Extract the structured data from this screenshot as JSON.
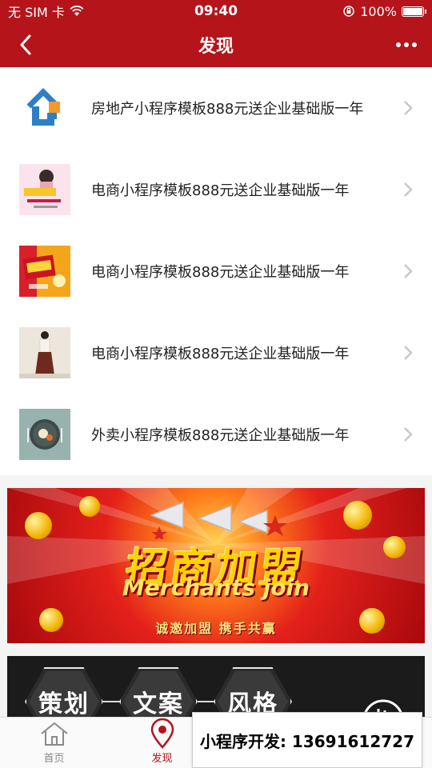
{
  "statusbar": {
    "carrier": "无 SIM 卡",
    "time": "09:40",
    "battery": "100%"
  },
  "navbar": {
    "title": "发现",
    "back_icon": "chevron-left-icon",
    "more_icon": "more-dots-icon"
  },
  "items": [
    {
      "title": "房地产小程序模板888元送企业基础版一年",
      "thumb": "real-estate-logo"
    },
    {
      "title": "电商小程序模板888元送企业基础版一年",
      "thumb": "ecommerce-promo-1"
    },
    {
      "title": "电商小程序模板888元送企业基础版一年",
      "thumb": "ecommerce-promo-2"
    },
    {
      "title": "电商小程序模板888元送企业基础版一年",
      "thumb": "fashion-model"
    },
    {
      "title": "外卖小程序模板888元送企业基础版一年",
      "thumb": "food-plate"
    }
  ],
  "banner": {
    "main": "招商加盟",
    "english": "Merchants join",
    "slogan": "诚邀加盟   携手共赢"
  },
  "banner2": {
    "labels": [
      "策划",
      "文案",
      "风格"
    ]
  },
  "tabbar": {
    "tabs": [
      {
        "label": "首页"
      },
      {
        "label": "发现"
      },
      {
        "label": ""
      },
      {
        "label": ""
      }
    ]
  },
  "contact": {
    "text": "小程序开发: 13691612727"
  },
  "colors": {
    "brand": "#b5141b"
  }
}
